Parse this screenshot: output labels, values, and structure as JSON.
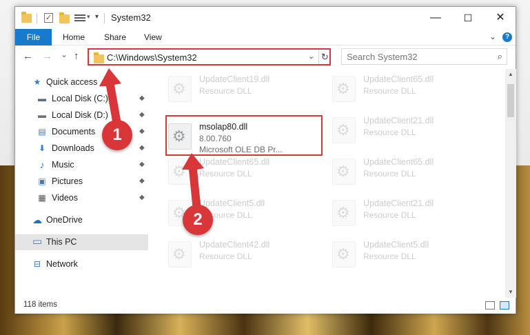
{
  "window": {
    "title": "System32",
    "minimize": "—",
    "maximize": "☐",
    "close": "✕"
  },
  "ribbon": {
    "tabs": [
      "File",
      "Home",
      "Share",
      "View"
    ],
    "expand_icon": "chevron-down-icon",
    "help": "?"
  },
  "nav": {
    "back": "←",
    "forward": "→",
    "recent": "⌄",
    "up": "↑",
    "address": "C:\\Windows\\System32",
    "address_dropdown": "⌄",
    "refresh": "↻",
    "search_placeholder": "Search System32",
    "search_icon": "⌕"
  },
  "sidebar": {
    "items": [
      {
        "label": "Quick access",
        "icon": "star-icon",
        "glyph": "★",
        "color": "#2f7fd0",
        "pinned": false
      },
      {
        "label": "Local Disk (C:)",
        "icon": "drive-icon",
        "glyph": "▬",
        "color": "#5b6f80",
        "pinned": true
      },
      {
        "label": "Local Disk (D:)",
        "icon": "drive-icon",
        "glyph": "▬",
        "color": "#707070",
        "pinned": true
      },
      {
        "label": "Documents",
        "icon": "documents-icon",
        "glyph": "▤",
        "color": "#4a7aa8",
        "pinned": true
      },
      {
        "label": "Downloads",
        "icon": "download-icon",
        "glyph": "⬇",
        "color": "#2f7fd0",
        "pinned": true
      },
      {
        "label": "Music",
        "icon": "music-icon",
        "glyph": "♪",
        "color": "#2f7fd0",
        "pinned": true
      },
      {
        "label": "Pictures",
        "icon": "pictures-icon",
        "glyph": "▣",
        "color": "#4a7aa8",
        "pinned": true
      },
      {
        "label": "Videos",
        "icon": "videos-icon",
        "glyph": "▦",
        "color": "#555555",
        "pinned": true
      },
      {
        "label": "OneDrive",
        "icon": "cloud-icon",
        "glyph": "☁",
        "color": "#1a6fc4",
        "pinned": false
      },
      {
        "label": "This PC",
        "icon": "computer-icon",
        "glyph": "▭",
        "color": "#2f7fd0",
        "pinned": false
      },
      {
        "label": "Network",
        "icon": "network-icon",
        "glyph": "⊟",
        "color": "#2f7fd0",
        "pinned": false
      }
    ],
    "pin_glyph": "📌"
  },
  "files": [
    {
      "name": "UpdateClient19.dll",
      "line2": "Resource DLL",
      "line3": "",
      "faded": true
    },
    {
      "name": "UpdateClient65.dll",
      "line2": "Resource DLL",
      "line3": "",
      "faded": true
    },
    {
      "name": "msolap80.dll",
      "line2": "8.00.760",
      "line3": "Microsoft OLE DB Pr...",
      "faded": false
    },
    {
      "name": "UpdateClient21.dll",
      "line2": "Resource DLL",
      "line3": "",
      "faded": true
    },
    {
      "name": "UpdateClient65.dll",
      "line2": "Resource DLL",
      "line3": "",
      "faded": true
    },
    {
      "name": "UpdateClient65.dll",
      "line2": "Resource DLL",
      "line3": "",
      "faded": true
    },
    {
      "name": "UpdateClient5.dll",
      "line2": "Resource DLL",
      "line3": "",
      "faded": true
    },
    {
      "name": "UpdateClient21.dll",
      "line2": "Resource DLL",
      "line3": "",
      "faded": true
    },
    {
      "name": "UpdateClient42.dll",
      "line2": "Resource DLL",
      "line3": "",
      "faded": true
    },
    {
      "name": "UpdateClient5.dll",
      "line2": "Resource DLL",
      "line3": "",
      "faded": true
    }
  ],
  "status": {
    "item_count": "118 items"
  },
  "annotations": {
    "step1": "1",
    "step2": "2",
    "color": "#d9363a"
  }
}
